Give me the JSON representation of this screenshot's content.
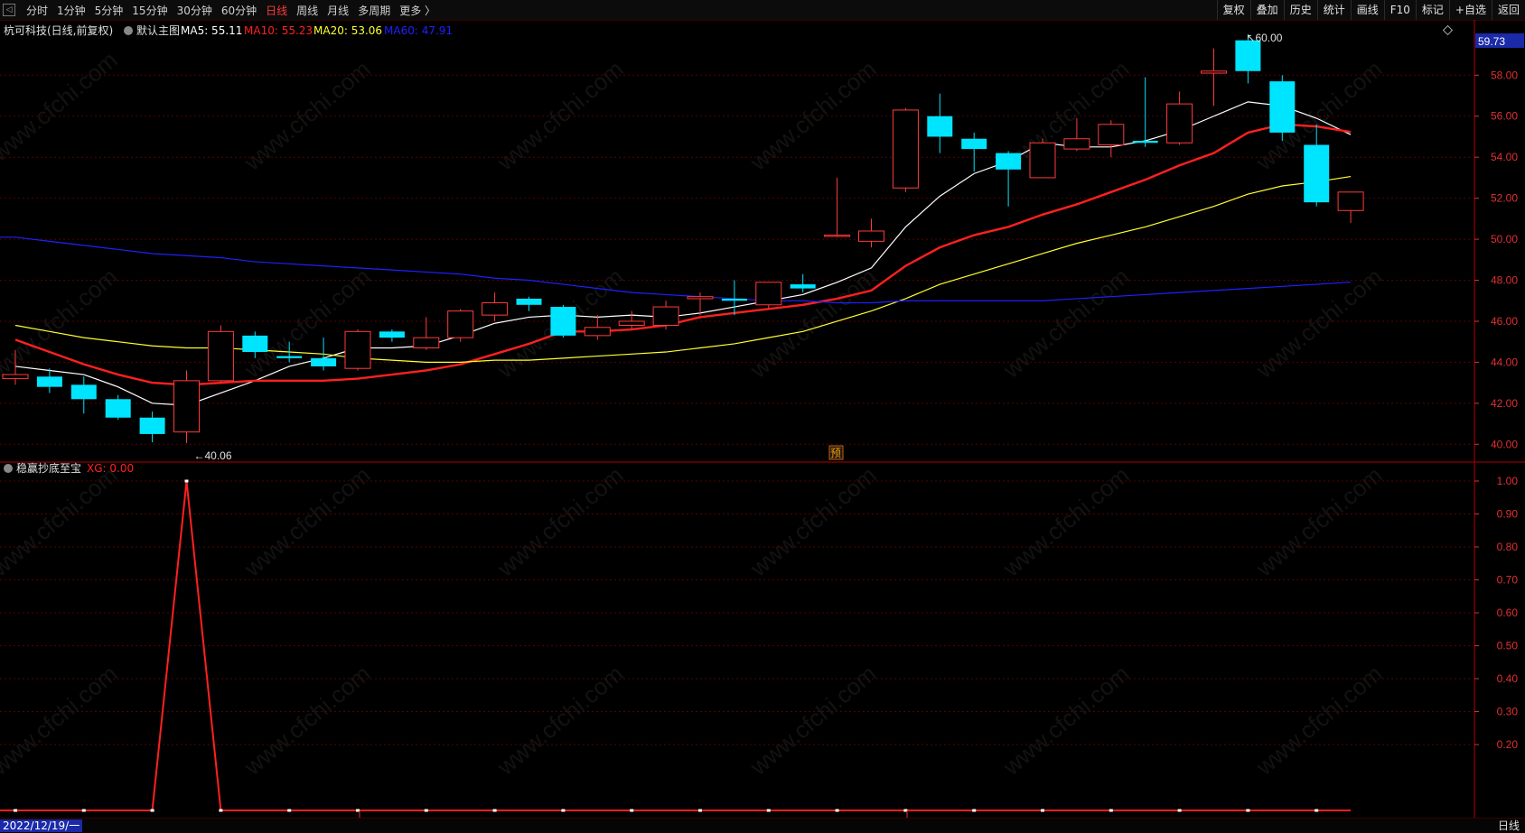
{
  "toolbar": {
    "periods": [
      "分时",
      "1分钟",
      "5分钟",
      "15分钟",
      "30分钟",
      "60分钟",
      "日线",
      "周线",
      "月线",
      "多周期",
      "更多 〉"
    ],
    "active_period": "日线",
    "right_buttons": [
      "复权",
      "叠加",
      "历史",
      "统计",
      "画线",
      "F10",
      "标记",
      "+自选",
      "返回"
    ]
  },
  "main_panel": {
    "title": "杭可科技(日线,前复权)",
    "template": "默认主图",
    "ma_legends": [
      {
        "label": "MA5: 55.11",
        "color": "#ffffff"
      },
      {
        "label": "MA10: 55.23",
        "color": "#ff2020"
      },
      {
        "label": "MA20: 53.06",
        "color": "#ffff30"
      },
      {
        "label": "MA60: 47.91",
        "color": "#2020ff"
      }
    ],
    "current_price_label": "59.73",
    "high_annotation": "60.00",
    "low_annotation": "40.06",
    "marker_label": "预"
  },
  "indicator_panel": {
    "title": "稳赢抄底至宝",
    "value_label": "XG: 0.00"
  },
  "status": {
    "date": "2022/12/19/一",
    "period": "日线",
    "month_marks": [
      "1",
      "2"
    ]
  },
  "watermark_text": "www.cfchi.com",
  "colors": {
    "up": "#ff3b3b",
    "down": "#00e5ff",
    "grid": "#5a0000",
    "axis": "#e03030"
  },
  "chart_data": [
    {
      "type": "candlestick",
      "ylim": [
        39,
        59.73
      ],
      "y_ticks": [
        40,
        42,
        44,
        46,
        48,
        50,
        52,
        54,
        56,
        58
      ],
      "tick_format": "0.00",
      "ohlc": [
        [
          43.2,
          44.6,
          42.9,
          43.4
        ],
        [
          43.3,
          43.7,
          42.5,
          42.8
        ],
        [
          42.9,
          43.3,
          41.5,
          42.2
        ],
        [
          42.2,
          42.4,
          41.2,
          41.3
        ],
        [
          41.3,
          41.6,
          40.1,
          40.5
        ],
        [
          40.6,
          43.6,
          40.06,
          43.1
        ],
        [
          43.1,
          45.8,
          43.0,
          45.5
        ],
        [
          45.3,
          45.5,
          44.2,
          44.5
        ],
        [
          44.3,
          45.0,
          44.0,
          44.2
        ],
        [
          44.2,
          45.2,
          43.6,
          43.8
        ],
        [
          43.7,
          45.6,
          43.6,
          45.5
        ],
        [
          45.5,
          45.6,
          45.0,
          45.2
        ],
        [
          44.7,
          46.2,
          44.6,
          45.2
        ],
        [
          45.2,
          46.6,
          45.0,
          46.5
        ],
        [
          46.3,
          47.4,
          46.0,
          46.9
        ],
        [
          47.1,
          47.2,
          46.5,
          46.8
        ],
        [
          46.7,
          46.8,
          45.2,
          45.3
        ],
        [
          45.3,
          46.3,
          45.1,
          45.7
        ],
        [
          45.8,
          46.5,
          45.6,
          46.0
        ],
        [
          45.8,
          47.0,
          45.6,
          46.7
        ],
        [
          47.1,
          47.4,
          46.3,
          47.2
        ],
        [
          47.1,
          48.0,
          46.3,
          47.0
        ],
        [
          46.8,
          47.9,
          46.6,
          47.9
        ],
        [
          47.8,
          48.3,
          47.4,
          47.6
        ],
        [
          50.2,
          53.0,
          50.1,
          50.2
        ],
        [
          49.9,
          51.0,
          49.6,
          50.4
        ],
        [
          52.5,
          56.4,
          52.3,
          56.3
        ],
        [
          56.0,
          57.1,
          54.2,
          55.0
        ],
        [
          54.9,
          55.2,
          53.3,
          54.4
        ],
        [
          54.2,
          54.3,
          51.6,
          53.4
        ],
        [
          53.0,
          54.9,
          53.0,
          54.7
        ],
        [
          54.4,
          55.9,
          54.3,
          54.9
        ],
        [
          54.6,
          55.8,
          54.0,
          55.6
        ],
        [
          54.8,
          57.9,
          54.5,
          54.7
        ],
        [
          54.7,
          57.2,
          54.6,
          56.6
        ],
        [
          58.1,
          59.3,
          56.5,
          58.2
        ],
        [
          59.7,
          60.0,
          57.6,
          58.2
        ],
        [
          57.7,
          58.0,
          54.8,
          55.2
        ],
        [
          54.6,
          55.6,
          51.6,
          51.8
        ],
        [
          51.4,
          52.3,
          50.8,
          52.3
        ]
      ],
      "series": [
        {
          "name": "MA5",
          "values": [
            43.8,
            43.6,
            43.4,
            42.8,
            42.0,
            41.9,
            42.5,
            43.1,
            43.8,
            44.2,
            44.7,
            44.7,
            44.8,
            45.3,
            45.9,
            46.2,
            46.3,
            46.2,
            46.3,
            46.2,
            46.4,
            46.7,
            47.0,
            47.3,
            47.9,
            48.6,
            50.6,
            52.1,
            53.2,
            53.8,
            54.7,
            54.5,
            54.5,
            54.8,
            55.3,
            56.0,
            56.7,
            56.5,
            55.9,
            55.1
          ]
        },
        {
          "name": "MA10",
          "values": [
            45.1,
            44.5,
            43.9,
            43.4,
            43.0,
            42.9,
            43.0,
            43.1,
            43.1,
            43.1,
            43.2,
            43.4,
            43.6,
            43.9,
            44.4,
            44.9,
            45.5,
            45.5,
            45.6,
            45.8,
            46.2,
            46.4,
            46.6,
            46.8,
            47.1,
            47.5,
            48.7,
            49.6,
            50.2,
            50.6,
            51.2,
            51.7,
            52.3,
            52.9,
            53.6,
            54.2,
            55.2,
            55.6,
            55.5,
            55.23
          ]
        },
        {
          "name": "MA20",
          "values": [
            45.8,
            45.5,
            45.2,
            45.0,
            44.8,
            44.7,
            44.7,
            44.6,
            44.5,
            44.4,
            44.2,
            44.1,
            44.0,
            44.0,
            44.1,
            44.1,
            44.2,
            44.3,
            44.4,
            44.5,
            44.7,
            44.9,
            45.2,
            45.5,
            46.0,
            46.5,
            47.1,
            47.8,
            48.3,
            48.8,
            49.3,
            49.8,
            50.2,
            50.6,
            51.1,
            51.6,
            52.2,
            52.6,
            52.8,
            53.06
          ]
        },
        {
          "name": "MA60",
          "values": [
            50.1,
            49.9,
            49.7,
            49.5,
            49.3,
            49.2,
            49.1,
            48.9,
            48.8,
            48.7,
            48.6,
            48.5,
            48.4,
            48.3,
            48.1,
            48.0,
            47.8,
            47.6,
            47.4,
            47.3,
            47.2,
            47.1,
            47.0,
            47.0,
            46.9,
            46.9,
            47.0,
            47.0,
            47.0,
            47.0,
            47.0,
            47.1,
            47.2,
            47.3,
            47.4,
            47.5,
            47.6,
            47.7,
            47.8,
            47.91
          ]
        }
      ]
    },
    {
      "type": "line",
      "name": "XG",
      "ylim": [
        0,
        1.0
      ],
      "y_ticks": [
        0.2,
        0.3,
        0.4,
        0.5,
        0.6,
        0.7,
        0.8,
        0.9,
        1.0
      ],
      "tick_format": "0.00",
      "values": [
        0,
        0,
        0,
        0,
        0,
        1,
        0,
        0,
        0,
        0,
        0,
        0,
        0,
        0,
        0,
        0,
        0,
        0,
        0,
        0,
        0,
        0,
        0,
        0,
        0,
        0,
        0,
        0,
        0,
        0,
        0,
        0,
        0,
        0,
        0,
        0,
        0,
        0,
        0,
        0
      ]
    }
  ]
}
